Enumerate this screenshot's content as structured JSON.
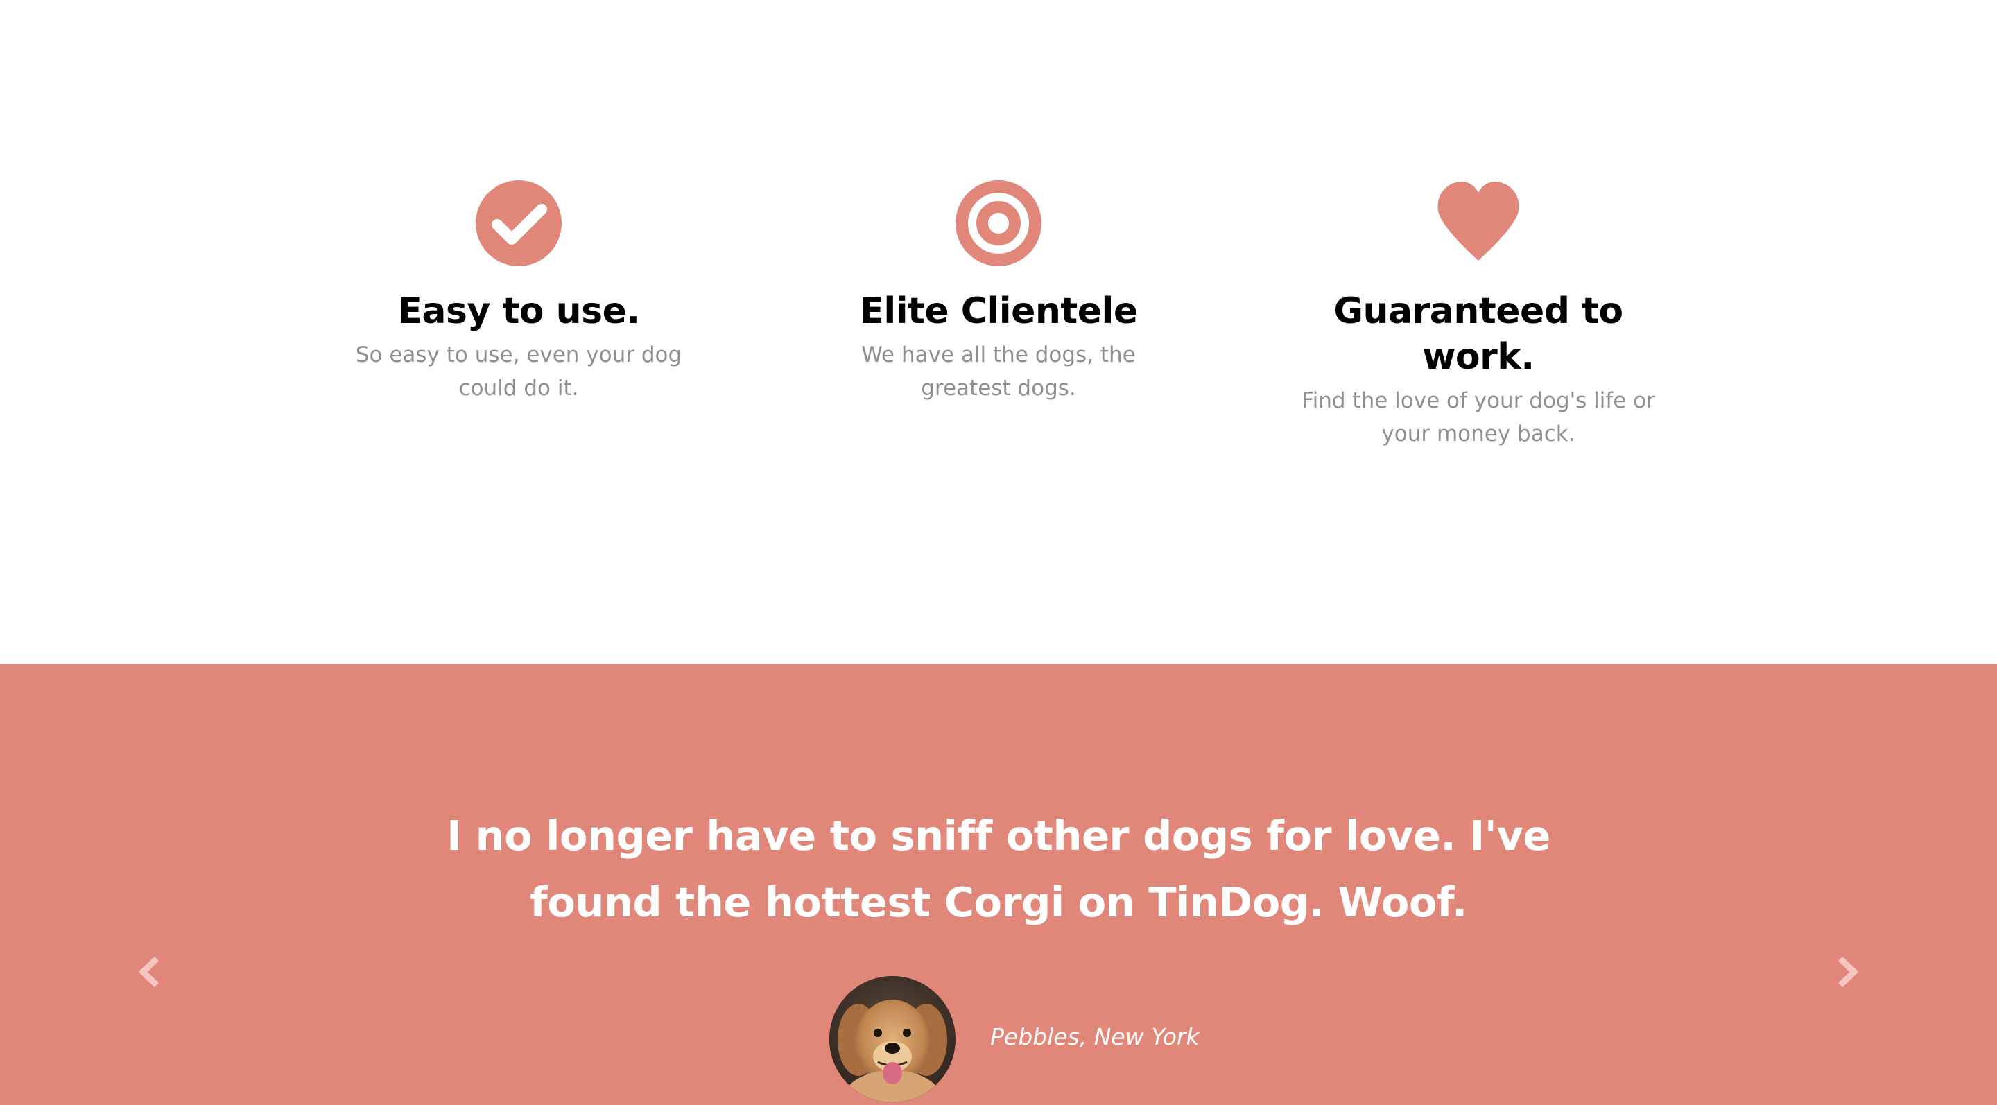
{
  "features": [
    {
      "icon": "check-circle-icon",
      "title": "Easy to use.",
      "text": "So easy to use, even your dog could do it."
    },
    {
      "icon": "bullseye-icon",
      "title": "Elite Clientele",
      "text": "We have all the dogs, the greatest dogs."
    },
    {
      "icon": "heart-icon",
      "title": "Guaranteed to work.",
      "text": "Find the love of your dog's life or your money back."
    }
  ],
  "testimonial": {
    "quote": "I no longer have to sniff other dogs for love. I've found the hottest Corgi on TinDog. Woof.",
    "author": "Pebbles, New York",
    "avatar_icon": "dog-avatar",
    "prev_icon": "chevron-left-icon",
    "next_icon": "chevron-right-icon"
  },
  "colors": {
    "accent": "#e08779",
    "heading": "#000000",
    "body_text": "#8f8f8f",
    "background": "#ffffff",
    "on_accent": "#ffffff"
  }
}
